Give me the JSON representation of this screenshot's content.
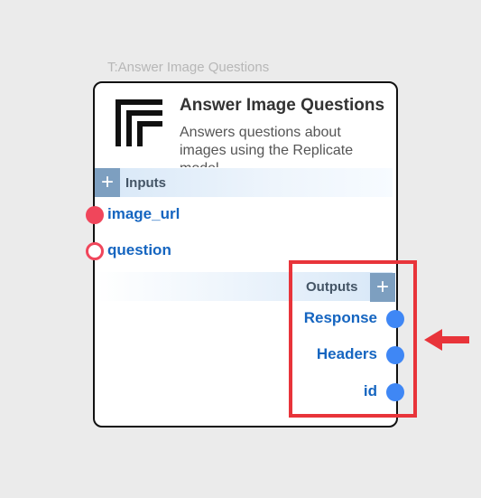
{
  "node": {
    "caption": "T:Answer Image Questions",
    "title": "Answer Image Questions",
    "description": "Answers questions about images using the Replicate model",
    "logo_icon": "replicate-logo-icon"
  },
  "inputs": {
    "section_label": "Inputs",
    "add_button_label": "+",
    "ports": [
      {
        "label": "image_url",
        "connected": true
      },
      {
        "label": "question",
        "connected": false
      }
    ]
  },
  "outputs": {
    "section_label": "Outputs",
    "add_button_label": "+",
    "ports": [
      {
        "label": "Response"
      },
      {
        "label": "Headers"
      },
      {
        "label": "id"
      }
    ]
  },
  "annotations": {
    "highlight_color": "#e8343a",
    "arrow_icon": "left-arrow-icon"
  },
  "colors": {
    "input_port": "#f0465b",
    "output_port": "#3f87f5",
    "port_label": "#1565c0",
    "add_button": "#7d9fc0"
  }
}
